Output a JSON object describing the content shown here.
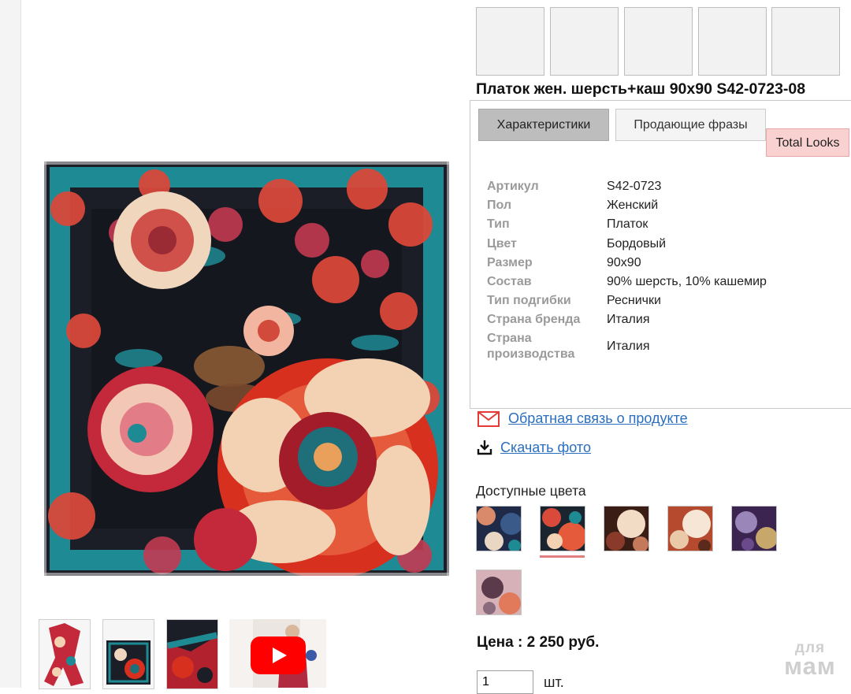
{
  "product": {
    "title": "Платок жен. шерсть+каш 90х90 S42-0723-08"
  },
  "tabs": [
    {
      "label": "Характеристики",
      "active": true
    },
    {
      "label": "Продающие фразы",
      "active": false
    },
    {
      "label": "Total Looks",
      "active": false
    }
  ],
  "specs": [
    {
      "label": "Артикул",
      "value": "S42-0723"
    },
    {
      "label": "Пол",
      "value": "Женский"
    },
    {
      "label": "Тип",
      "value": "Платок"
    },
    {
      "label": "Цвет",
      "value": "Бордовый"
    },
    {
      "label": "Размер",
      "value": "90х90"
    },
    {
      "label": "Состав",
      "value": "90% шерсть, 10% кашемир"
    },
    {
      "label": "Тип подгибки",
      "value": "Реснички"
    },
    {
      "label": "Страна бренда",
      "value": "Италия"
    },
    {
      "label": "Страна производства",
      "value": "Италия"
    }
  ],
  "links": {
    "feedback": "Обратная связь о продукте",
    "download": "Скачать фото"
  },
  "colors": {
    "title": "Доступные цвета",
    "swatches": [
      {
        "name": "navy",
        "bg": "#1f2a48",
        "accent": "#d98a6a",
        "selected": false
      },
      {
        "name": "burgundy",
        "bg": "#1a2530",
        "accent": "#d94a3a",
        "selected": true
      },
      {
        "name": "brown",
        "bg": "#3a1e16",
        "accent": "#f2dcc6",
        "selected": false
      },
      {
        "name": "terracotta",
        "bg": "#b54a2e",
        "accent": "#f5e6d6",
        "selected": false
      },
      {
        "name": "purple",
        "bg": "#3b2450",
        "accent": "#9a86b8",
        "selected": false
      },
      {
        "name": "pink-grey",
        "bg": "#d6b2b8",
        "accent": "#5b3a4c",
        "selected": false
      }
    ],
    "selected_indicator_color": "#e07f7f"
  },
  "price": {
    "label": "Цена : 2 250 руб."
  },
  "quantity": {
    "value": "1",
    "unit": "шт."
  },
  "watermark": {
    "small": "для",
    "big": "мам"
  },
  "theme": {
    "link_color": "#2a6fbf",
    "tab_active_bg": "#bdbdbd",
    "tab_looks_bg": "#f9d1d1",
    "mail_icon_color": "#e53935"
  }
}
